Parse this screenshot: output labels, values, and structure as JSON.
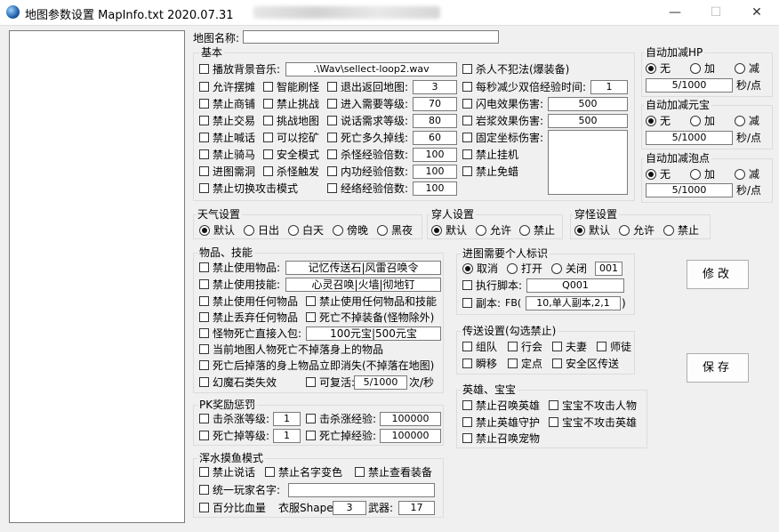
{
  "window": {
    "title": "地图参数设置 MapInfo.txt  2020.07.31",
    "minimize": "—",
    "maximize": "☐",
    "close": "✕"
  },
  "map_name": {
    "label": "地图名称:",
    "value": ""
  },
  "basic": {
    "title": "基本",
    "checkboxes": {
      "bg_music": "播放背景音乐:",
      "no_pk_crime": "杀人不犯法(爆装备)",
      "allow_stall": "允许摆摊",
      "smart_refresh": "智能刷怪",
      "exit_return": "退出返回地图:",
      "double_exp": "每秒减少双倍经验时间:",
      "no_shop": "禁止商铺",
      "no_challenge": "禁止挑战",
      "enter_level": "进入需要等级:",
      "lightning_dmg": "闪电效果伤害:",
      "no_trade": "禁止交易",
      "challenge_map": "挑战地图",
      "talk_level": "说话需求等级:",
      "lava_dmg": "岩浆效果伤害:",
      "no_shout": "禁止喊话",
      "can_mine": "可以挖矿",
      "death_drop": "死亡多久掉线:",
      "fixed_dmg": "固定坐标伤害:",
      "no_mount": "禁止骑马",
      "safe_mode": "安全模式",
      "kill_exp": "杀怪经验倍数:",
      "no_afk": "禁止挂机",
      "enter_cave": "进图需洞",
      "kill_trigger": "杀怪触发",
      "inner_exp": "内功经验倍数:",
      "no_free_trans": "禁止免蜡",
      "no_attack_mode": "禁止切换攻击模式",
      "meridian_exp": "经络经验倍数:"
    },
    "values": {
      "bg_music": ".\\Wav\\sellect-loop2.wav",
      "exit_return": "3",
      "double_exp": "1",
      "enter_level": "70",
      "lightning_dmg": "500",
      "talk_level": "80",
      "lava_dmg": "500",
      "death_drop": "60",
      "kill_exp": "100",
      "inner_exp": "100",
      "meridian_exp": "100"
    }
  },
  "auto_hp": {
    "title": "自动加减HP",
    "none": "无",
    "add": "加",
    "sub": "减",
    "value": "5/1000",
    "unit": "秒/点"
  },
  "auto_yuanbao": {
    "title": "自动加减元宝",
    "none": "无",
    "add": "加",
    "sub": "减",
    "value": "5/1000",
    "unit": "秒/点"
  },
  "auto_paopao": {
    "title": "自动加减泡点",
    "none": "无",
    "add": "加",
    "sub": "减",
    "value": "5/1000",
    "unit": "秒/点"
  },
  "weather": {
    "title": "天气设置",
    "options": [
      "默认",
      "日出",
      "白天",
      "傍晚",
      "黑夜"
    ],
    "selected": "默认"
  },
  "pass_person": {
    "title": "穿人设置",
    "options": [
      "默认",
      "允许",
      "禁止"
    ],
    "selected": "默认"
  },
  "pass_monster": {
    "title": "穿怪设置",
    "options": [
      "默认",
      "允许",
      "禁止"
    ],
    "selected": "默认"
  },
  "items": {
    "title": "物品、技能",
    "no_use_item": "禁止使用物品:",
    "no_use_item_value": "记忆传送石|风雷召唤令",
    "no_use_skill": "禁止使用技能:",
    "no_use_skill_value": "心灵召唤|火墙|彻地钉",
    "no_any_item": "禁止使用任何物品",
    "no_any_item_skill": "禁止使用任何物品和技能",
    "no_drop_any": "禁止丢弃任何物品",
    "death_no_drop": "死亡不掉装备(怪物除外)",
    "monster_drop_bag": "怪物死亡直接入包:",
    "monster_drop_bag_value": "100元宝|500元宝",
    "player_no_drop": "当前地图人物死亡不掉落身上的物品",
    "drop_vanish": "死亡后掉落的身上物品立即消失(不掉落在地图)",
    "stone_fail": "幻魔石类失效",
    "can_revive": "可复活:",
    "revive_value": "5/1000",
    "revive_unit": "次/秒"
  },
  "pk": {
    "title": "PK奖励惩罚",
    "kill_level": "击杀涨等级:",
    "kill_level_value": "1",
    "kill_exp": "击杀涨经验:",
    "kill_exp_value": "100000",
    "death_level": "死亡掉等级:",
    "death_level_value": "1",
    "death_exp": "死亡掉经验:",
    "death_exp_value": "100000"
  },
  "muddy": {
    "title": "浑水摸鱼模式",
    "no_talk": "禁止说话",
    "no_name_color": "禁止名字变色",
    "no_view_equip": "禁止查看装备",
    "unified_name": "统一玩家名字:",
    "unified_name_value": "",
    "percent_hp": "百分比血量",
    "cloth_shape": "衣服Shape:",
    "cloth_shape_value": "3",
    "weapon": "武器:",
    "weapon_value": "17"
  },
  "identity": {
    "title": "进图需要个人标识",
    "options": [
      "取消",
      "打开",
      "关闭"
    ],
    "selected": "取消",
    "id_value": "001",
    "exec_script": "执行脚本:",
    "exec_script_value": "Q001",
    "dungeon": "副本:",
    "dungeon_prefix": "FB(",
    "dungeon_value": "10,单人副本,2,1",
    "dungeon_suffix": ")"
  },
  "teleport": {
    "title": "传送设置(勾选禁止)",
    "group": "组队",
    "guild": "行会",
    "couple": "夫妻",
    "master": "师徒",
    "instant": "瞬移",
    "fixed": "定点",
    "safe_zone": "安全区传送"
  },
  "hero": {
    "title": "英雄、宝宝",
    "no_call_hero": "禁止召唤英雄",
    "pet_no_attack_player": "宝宝不攻击人物",
    "no_hero_guard": "禁止英雄守护",
    "pet_no_attack_hero": "宝宝不攻击英雄",
    "no_call_pet": "禁止召唤宠物"
  },
  "buttons": {
    "modify": "修改",
    "save": "保存"
  }
}
